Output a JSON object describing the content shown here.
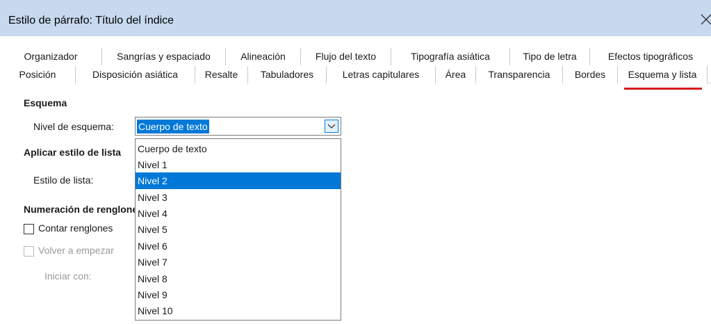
{
  "window": {
    "title": "Estilo de párrafo: Título del índice"
  },
  "tabs": {
    "row1": [
      "Organizador",
      "Sangrías y espaciado",
      "Alineación",
      "Flujo del texto",
      "Tipografía asiática",
      "Tipo de letra",
      "Efectos tipográficos"
    ],
    "row2": [
      "Posición",
      "Disposición asiática",
      "Resalte",
      "Tabuladores",
      "Letras capitulares",
      "Área",
      "Transparencia",
      "Bordes",
      "Esquema y lista"
    ],
    "active": "Esquema y lista",
    "accent_color": "#d71920"
  },
  "esquema": {
    "heading": "Esquema",
    "nivel_label": "Nivel de esquema:",
    "nivel_value": "Cuerpo de texto"
  },
  "lista": {
    "heading": "Aplicar estilo de lista",
    "estilo_label": "Estilo de lista:"
  },
  "numeracion": {
    "heading": "Numeración de renglones",
    "contar_label": "Contar renglones",
    "volver_label": "Volver a empezar",
    "iniciar_label": "Iniciar con:"
  },
  "dropdown": {
    "options": [
      "Cuerpo de texto",
      "Nivel 1",
      "Nivel 2",
      "Nivel 3",
      "Nivel 4",
      "Nivel 5",
      "Nivel 6",
      "Nivel 7",
      "Nivel 8",
      "Nivel 9",
      "Nivel 10"
    ],
    "highlighted": "Nivel 2",
    "highlight_color": "#0078d7"
  },
  "icons": {
    "close": "close-icon",
    "dropdown": "chevron-down-icon"
  }
}
